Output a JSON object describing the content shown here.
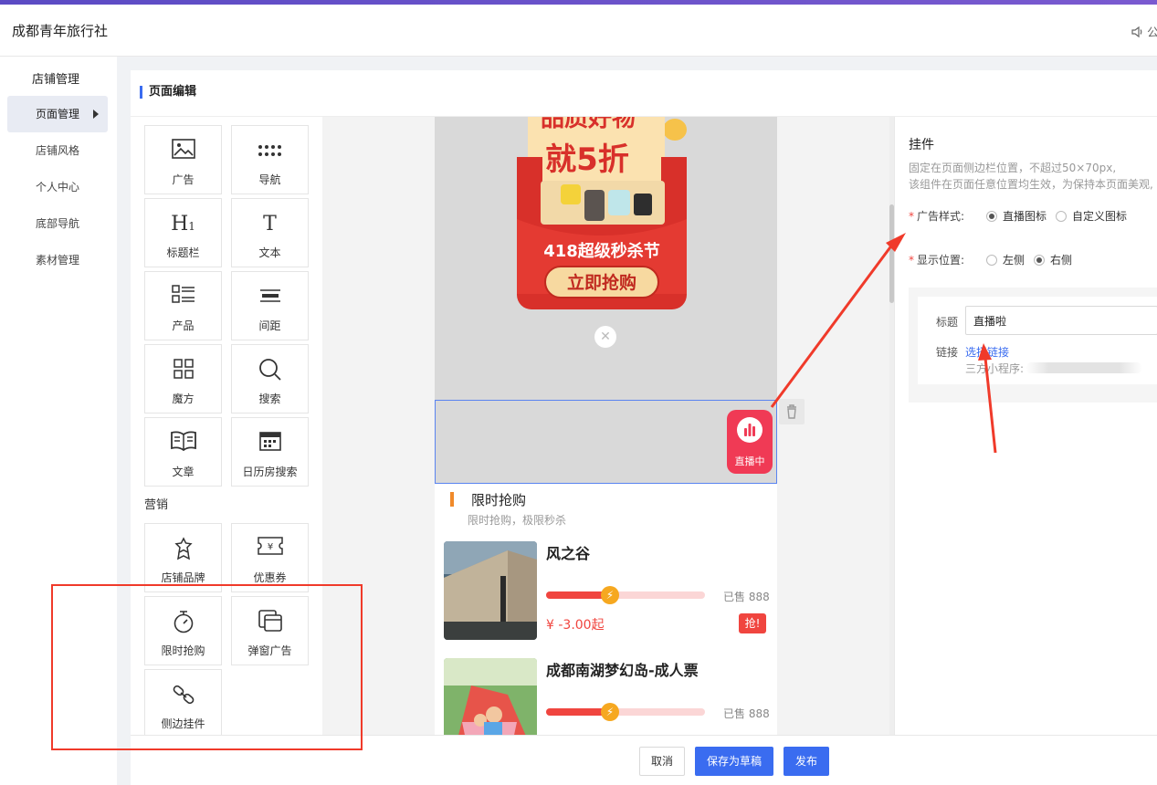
{
  "header": {
    "brand": "成都青年旅行社",
    "announcement_label": "公"
  },
  "sidebar": {
    "section": "店铺管理",
    "items": [
      {
        "label": "页面管理",
        "active": true
      },
      {
        "label": "店铺风格"
      },
      {
        "label": "个人中心"
      },
      {
        "label": "底部导航"
      },
      {
        "label": "素材管理"
      }
    ]
  },
  "panel": {
    "title": "页面编辑"
  },
  "palette": {
    "basic": [
      "广告",
      "导航",
      "标题栏",
      "文本",
      "产品",
      "间距",
      "魔方",
      "搜索",
      "文章",
      "日历房搜索"
    ],
    "marketing_label": "营销",
    "marketing": [
      "店铺品牌",
      "优惠券",
      "限时抢购",
      "弹窗广告",
      "侧边挂件"
    ]
  },
  "preview": {
    "poster": {
      "headline1": "品质好物",
      "headline2": "就5折",
      "festival": "418超级秒杀节",
      "cta": "立即抢购"
    },
    "live_badge": "直播中",
    "flash_sale": {
      "title": "限时抢购",
      "subtitle": "限时抢购，极限秒杀"
    },
    "products": [
      {
        "name": "风之谷",
        "sold": "已售 888",
        "price": "¥ -3.00起",
        "grab": "抢!",
        "progress": 0.4
      },
      {
        "name": "成都南湖梦幻岛-成人票",
        "sold": "已售 888",
        "price": "",
        "grab": "",
        "progress": 0.4
      }
    ]
  },
  "settings": {
    "title": "挂件",
    "desc1": "固定在页面侧边栏位置，不超过50×70px,",
    "desc2": "该组件在页面任意位置均生效，为保持本页面美观,",
    "ad_style": {
      "label": "广告样式:",
      "options": [
        "直播图标",
        "自定义图标"
      ],
      "selected": "直播图标"
    },
    "position": {
      "label": "显示位置:",
      "options": [
        "左侧",
        "右侧"
      ],
      "selected": "右侧"
    },
    "item": {
      "title_label": "标题",
      "title_value": "直播啦",
      "link_label": "链接",
      "link_action": "选择链接",
      "mini_program": "三方小程序:"
    }
  },
  "footer": {
    "cancel": "取消",
    "save_draft": "保存为草稿",
    "publish": "发布"
  },
  "colors": {
    "primary": "#3a6cf0",
    "danger": "#f0453f",
    "annotation": "#f03a2a"
  }
}
